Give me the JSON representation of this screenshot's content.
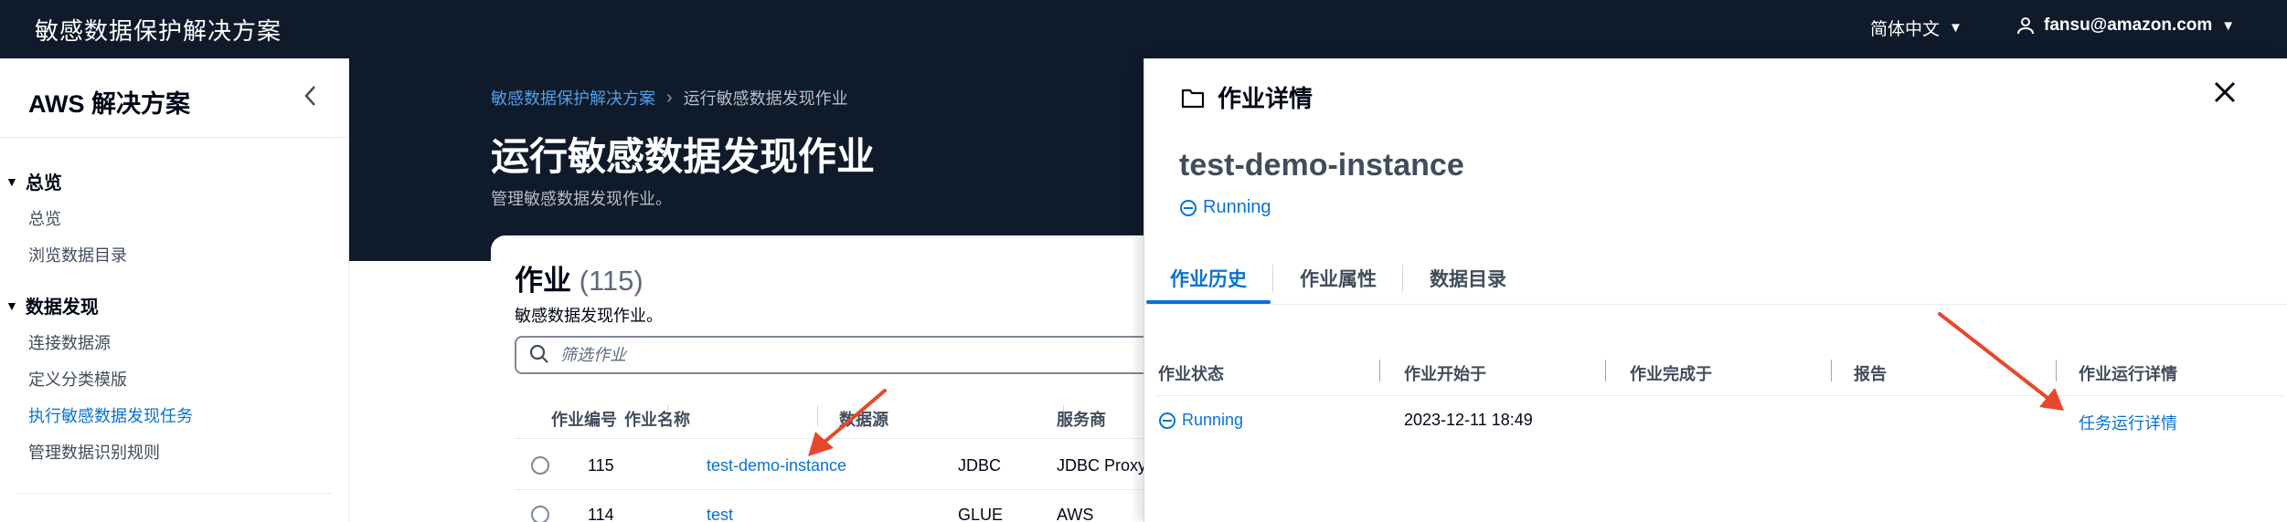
{
  "header": {
    "app_title": "敏感数据保护解决方案",
    "language": "简体中文",
    "user": "fansu@amazon.com"
  },
  "sidebar": {
    "title": "AWS 解决方案",
    "groups": [
      {
        "label": "总览",
        "items": [
          "总览",
          "浏览数据目录"
        ]
      },
      {
        "label": "数据发现",
        "items": [
          "连接数据源",
          "定义分类模版",
          "执行敏感数据发现任务",
          "管理数据识别规则"
        ]
      }
    ],
    "active_item": "执行敏感数据发现任务"
  },
  "breadcrumb": {
    "parent": "敏感数据保护解决方案",
    "current": "运行敏感数据发现作业"
  },
  "page": {
    "title": "运行敏感数据发现作业",
    "description": "管理敏感数据发现作业。"
  },
  "jobs": {
    "title": "作业",
    "count": "(115)",
    "subtitle": "敏感数据发现作业。",
    "filter_placeholder": "筛选作业",
    "columns": [
      "作业编号",
      "作业名称",
      "数据源",
      "服务商"
    ],
    "rows": [
      {
        "id": "115",
        "name": "test-demo-instance",
        "source": "JDBC",
        "provider": "JDBC Proxy"
      },
      {
        "id": "114",
        "name": "test",
        "source": "GLUE",
        "provider": "AWS"
      }
    ]
  },
  "detail": {
    "header": "作业详情",
    "instance_name": "test-demo-instance",
    "status": "Running",
    "tabs": [
      "作业历史",
      "作业属性",
      "数据目录"
    ],
    "active_tab": "作业历史",
    "history": {
      "columns": [
        "作业状态",
        "作业开始于",
        "作业完成于",
        "报告",
        "作业运行详情"
      ],
      "rows": [
        {
          "status": "Running",
          "started": "2023-12-11 18:49",
          "finished": "",
          "report": "",
          "details_link": "任务运行详情"
        }
      ]
    }
  },
  "colors": {
    "header_bg": "#0f1b2a",
    "link": "#0972d3",
    "arrow": "#e8472c"
  }
}
